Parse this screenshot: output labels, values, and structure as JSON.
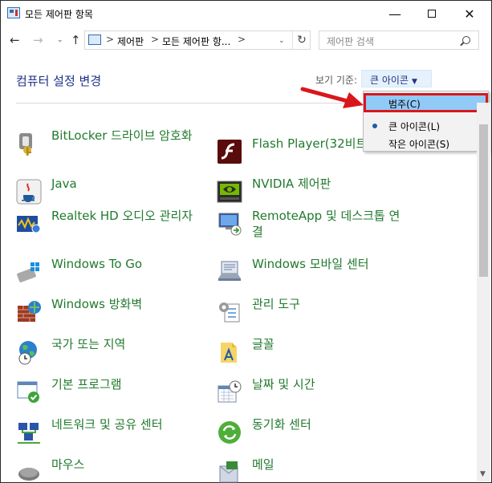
{
  "window": {
    "title": "모든 제어판 항목",
    "controls": {
      "minimize": "—",
      "maximize": "",
      "close": "✕"
    }
  },
  "nav": {
    "back": "←",
    "forward": "→",
    "recent": "⌄",
    "up": "↑",
    "separator": ">",
    "breadcrumbs": [
      "제어판",
      "모든 제어판 항..."
    ],
    "address_dropdown": "⌄",
    "refresh": "↻",
    "search_placeholder": "제어판 검색"
  },
  "header": {
    "title": "컴퓨터 설정 변경",
    "view_by_label": "보기 기준:",
    "view_by_value": "큰 아이콘",
    "view_by_caret": "▼"
  },
  "view_menu": {
    "items": [
      {
        "label": "범주(C)",
        "highlighted": true
      },
      {
        "label": "큰 아이콘(L)",
        "selected": true
      },
      {
        "label": "작은 아이콘(S)"
      }
    ]
  },
  "items_left": [
    {
      "label": "BitLocker 드라이브 암호화",
      "icon": "bitlocker-icon"
    },
    {
      "label": "Java",
      "icon": "java-icon"
    },
    {
      "label": "Realtek HD 오디오 관리자",
      "icon": "realtek-audio-icon"
    },
    {
      "label": "Windows To Go",
      "icon": "windows-to-go-icon"
    },
    {
      "label": "Windows 방화벽",
      "icon": "firewall-icon"
    },
    {
      "label": "국가 또는 지역",
      "icon": "region-icon"
    },
    {
      "label": "기본 프로그램",
      "icon": "default-programs-icon"
    },
    {
      "label": "네트워크 및 공유 센터",
      "icon": "network-icon"
    },
    {
      "label": "마우스",
      "icon": "mouse-icon"
    }
  ],
  "items_right": [
    {
      "label": "Flash Player(32비트)",
      "icon": "flash-icon"
    },
    {
      "label": "NVIDIA 제어판",
      "icon": "nvidia-icon"
    },
    {
      "label": "RemoteApp 및 데스크톱 연결",
      "icon": "remoteapp-icon"
    },
    {
      "label": "Windows 모바일 센터",
      "icon": "mobility-center-icon"
    },
    {
      "label": "관리 도구",
      "icon": "admin-tools-icon"
    },
    {
      "label": "글꼴",
      "icon": "fonts-icon"
    },
    {
      "label": "날짜 및 시간",
      "icon": "date-time-icon"
    },
    {
      "label": "동기화 센터",
      "icon": "sync-center-icon"
    },
    {
      "label": "메일",
      "icon": "mail-icon"
    }
  ],
  "colors": {
    "link_green": "#217a2d",
    "heading_blue": "#1e3287",
    "highlight": "#91c9f7",
    "annotation_red": "#d9171b"
  }
}
